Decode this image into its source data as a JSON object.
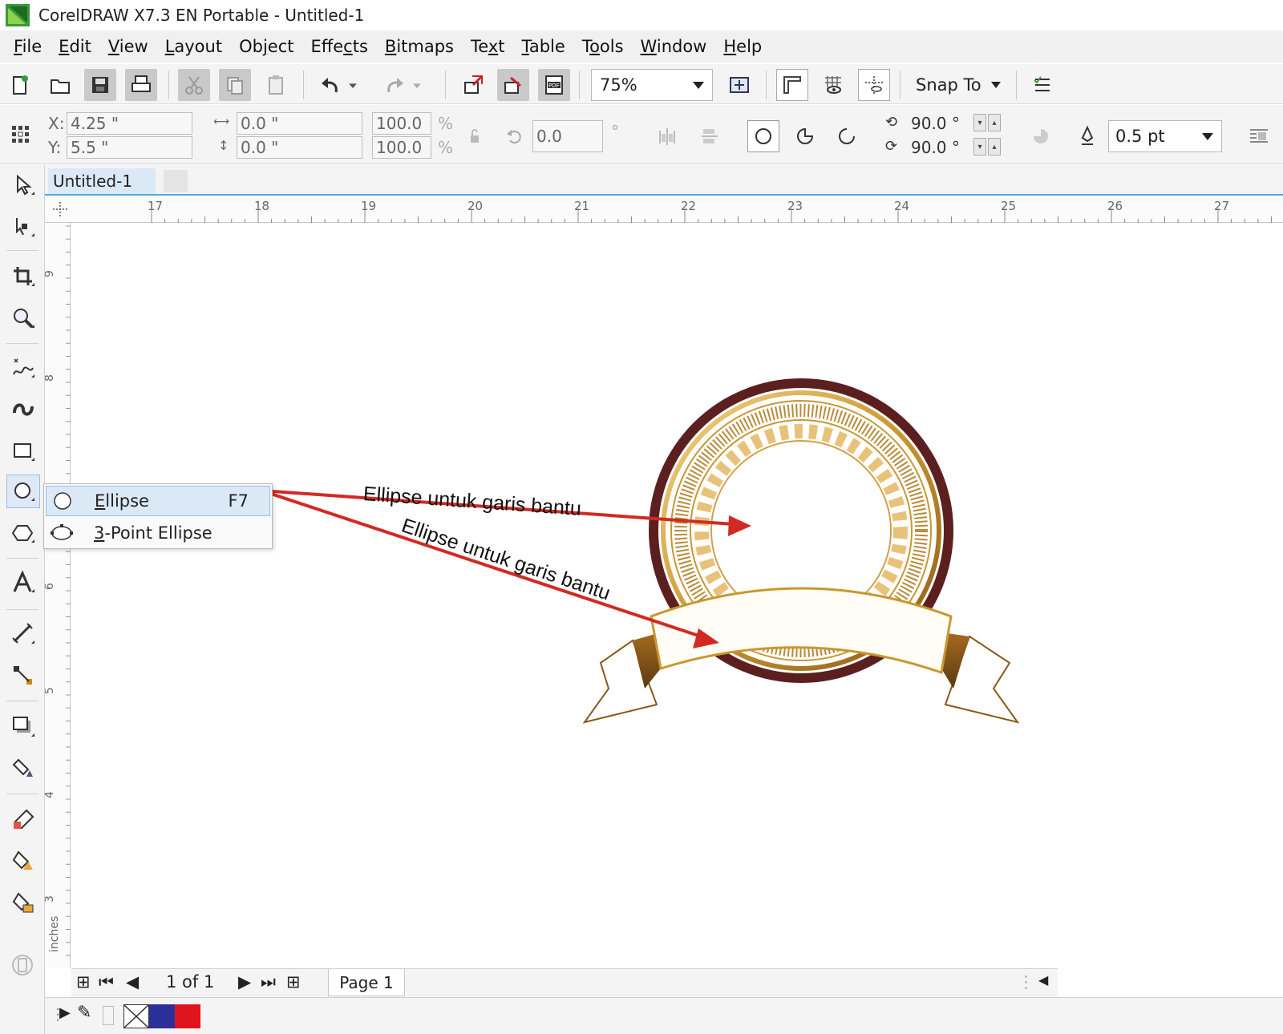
{
  "window": {
    "title": "CorelDRAW X7.3 EN Portable - Untitled-1"
  },
  "menu": [
    {
      "label": "File",
      "u": "F",
      "rest": "ile"
    },
    {
      "label": "Edit",
      "u": "E",
      "rest": "dit"
    },
    {
      "label": "View",
      "u": "V",
      "rest": "iew"
    },
    {
      "label": "Layout",
      "u": "L",
      "rest": "ayout"
    },
    {
      "label": "Object",
      "pre": "Ob",
      "u": "j",
      "rest": "ect"
    },
    {
      "label": "Effects",
      "pre": "Effe",
      "u": "c",
      "rest": "ts"
    },
    {
      "label": "Bitmaps",
      "u": "B",
      "rest": "itmaps"
    },
    {
      "label": "Text",
      "pre": "Te",
      "u": "x",
      "rest": "t"
    },
    {
      "label": "Table",
      "u": "T",
      "rest": "able"
    },
    {
      "label": "Tools",
      "pre": "T",
      "u": "o",
      "rest": "ols"
    },
    {
      "label": "Window",
      "u": "W",
      "rest": "indow"
    },
    {
      "label": "Help",
      "u": "H",
      "rest": "elp"
    }
  ],
  "toolbar": {
    "zoom_value": "75%",
    "snap_to_label": "Snap To"
  },
  "property_bar": {
    "x_label": "X:",
    "y_label": "Y:",
    "x_value": "4.25 \"",
    "y_value": "5.5 \"",
    "width_value": "0.0 \"",
    "height_value": "0.0 \"",
    "scale_x": "100.0",
    "scale_y": "100.0",
    "percent": "%",
    "rotation": "0.0",
    "degree": "°",
    "start_angle": "90.0 °",
    "end_angle": "90.0 °",
    "outline_width": "0.5 pt"
  },
  "document": {
    "tab_label": "Untitled-1"
  },
  "ruler": {
    "h_numbers": [
      "17",
      "18",
      "19",
      "20",
      "21",
      "22",
      "23",
      "24",
      "25",
      "26",
      "27"
    ],
    "v_numbers": [
      "9",
      "8",
      "6",
      "5",
      "4",
      "3"
    ],
    "unit_label": "inches"
  },
  "flyout": {
    "items": [
      {
        "label": "Ellipse",
        "u": "E",
        "rest": "llipse",
        "shortcut": "F7"
      },
      {
        "label": "3-Point Ellipse",
        "u": "3",
        "rest": "-Point Ellipse",
        "shortcut": ""
      }
    ]
  },
  "annotations": {
    "first": "Ellipse untuk garis bantu",
    "second": "Ellipse untuk garis bantu"
  },
  "page_nav": {
    "counter": "1 of 1",
    "page_tab": "Page 1"
  },
  "colors": {
    "accent": "#52a7dc",
    "arrow": "#d22a22",
    "badge_outer": "#5c1f1f",
    "badge_gold": "#c9972f",
    "palette_blue": "#2b2f9a",
    "palette_red": "#e0141c"
  }
}
